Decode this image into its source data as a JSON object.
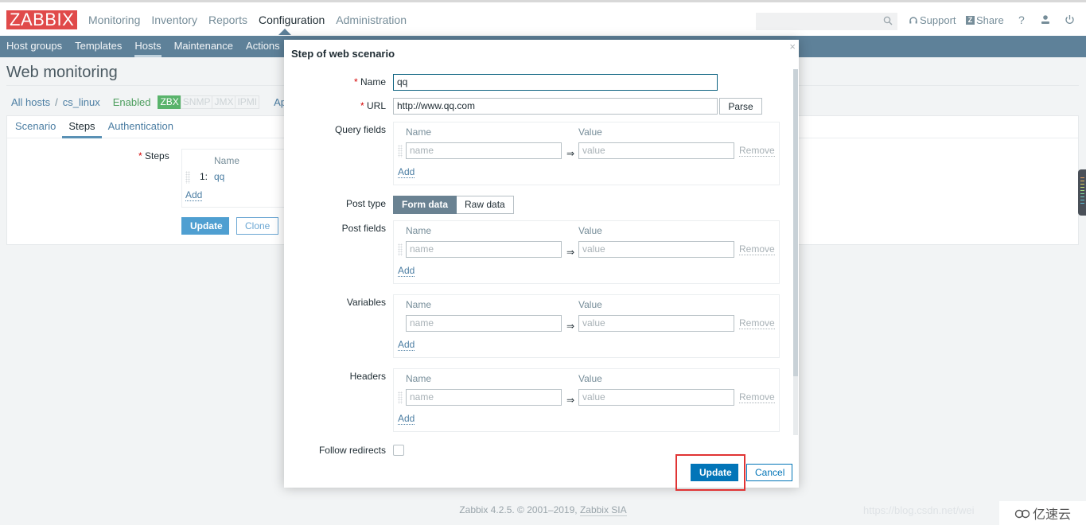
{
  "header": {
    "logo": "ZABBIX",
    "nav": [
      {
        "label": "Monitoring",
        "active": false
      },
      {
        "label": "Inventory",
        "active": false
      },
      {
        "label": "Reports",
        "active": false
      },
      {
        "label": "Configuration",
        "active": true
      },
      {
        "label": "Administration",
        "active": false
      }
    ],
    "search_placeholder": "",
    "support_label": "Support",
    "share_label": "Share",
    "help_label": "?"
  },
  "subnav": {
    "items": [
      {
        "label": "Host groups",
        "active": false
      },
      {
        "label": "Templates",
        "active": false
      },
      {
        "label": "Hosts",
        "active": true
      },
      {
        "label": "Maintenance",
        "active": false
      },
      {
        "label": "Actions",
        "active": false
      }
    ]
  },
  "page": {
    "title": "Web monitoring",
    "breadcrumb": {
      "all_hosts": "All hosts",
      "separator": "/",
      "host": "cs_linux"
    },
    "status": "Enabled",
    "availability": [
      "ZBX",
      "SNMP",
      "JMX",
      "IPMI"
    ],
    "app_link": "Ap",
    "tabs": [
      {
        "label": "Scenario",
        "active": false
      },
      {
        "label": "Steps",
        "active": true
      },
      {
        "label": "Authentication",
        "active": false
      }
    ],
    "steps": {
      "label": "Steps",
      "column_name": "Name",
      "rows": [
        {
          "num": "1:",
          "name": "qq"
        }
      ],
      "add_label": "Add"
    },
    "update_label": "Update",
    "clone_label": "Clone"
  },
  "modal": {
    "title": "Step of web scenario",
    "close_label": "×",
    "name_label": "Name",
    "name_value": "qq",
    "url_label": "URL",
    "url_value": "http://www.qq.com",
    "parse_label": "Parse",
    "query_fields": {
      "label": "Query fields",
      "col_name": "Name",
      "col_value": "Value",
      "name_placeholder": "name",
      "value_placeholder": "value",
      "remove_label": "Remove",
      "add_label": "Add"
    },
    "post_type": {
      "label": "Post type",
      "options": [
        "Form data",
        "Raw data"
      ],
      "selected": "Form data"
    },
    "post_fields": {
      "label": "Post fields",
      "col_name": "Name",
      "col_value": "Value",
      "name_placeholder": "name",
      "value_placeholder": "value",
      "remove_label": "Remove",
      "add_label": "Add"
    },
    "variables": {
      "label": "Variables",
      "col_name": "Name",
      "col_value": "Value",
      "name_placeholder": "name",
      "value_placeholder": "value",
      "remove_label": "Remove",
      "add_label": "Add"
    },
    "headers": {
      "label": "Headers",
      "col_name": "Name",
      "col_value": "Value",
      "name_placeholder": "name",
      "value_placeholder": "value",
      "remove_label": "Remove",
      "add_label": "Add"
    },
    "follow_redirects_label": "Follow redirects",
    "follow_redirects_checked": false,
    "update_label": "Update",
    "cancel_label": "Cancel",
    "arrow": "⇒"
  },
  "footer": {
    "text": "Zabbix 4.2.5. © 2001–2019, ",
    "link": "Zabbix SIA",
    "watermark": "https://blog.csdn.net/wei",
    "brand": "亿速云"
  },
  "colors": {
    "logo_bg": "#e04a4a",
    "subnav_bg": "#5e8199",
    "primary": "#0275b8",
    "enabled": "#59b36b",
    "highlight": "#e03434"
  }
}
